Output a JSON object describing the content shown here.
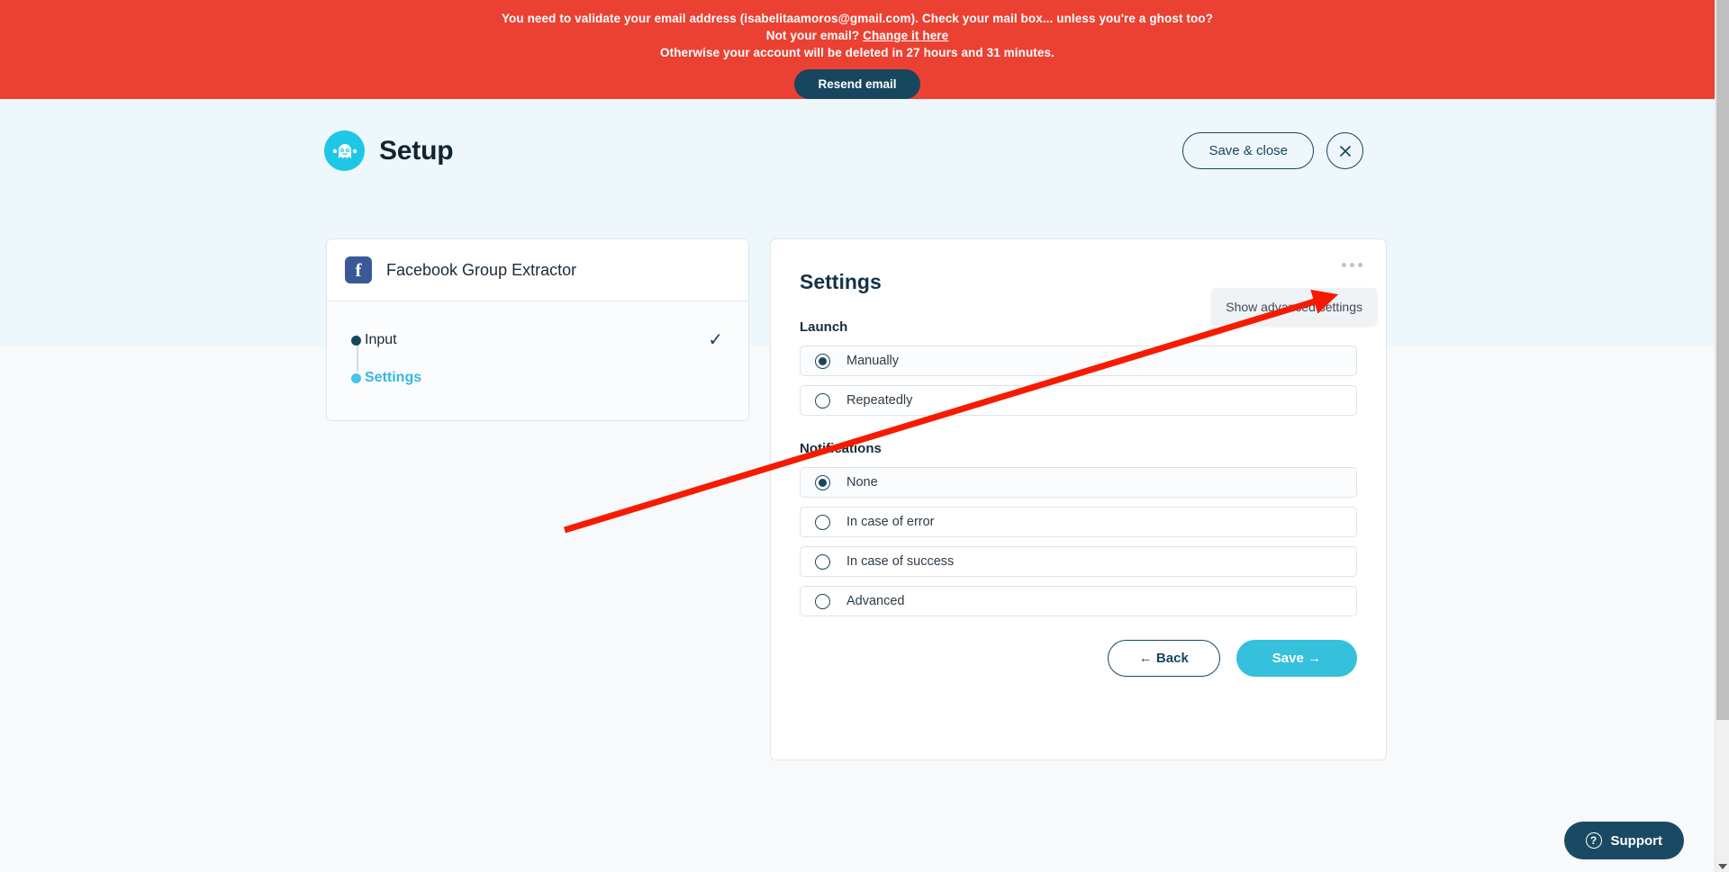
{
  "banner": {
    "line1": "You need to validate your email address (isabelitaamoros@gmail.com). Check your mail box... unless you're a ghost too?",
    "line2_prefix": "Not your email? ",
    "line2_link": "Change it here",
    "line3": "Otherwise your account will be deleted in 27 hours and 31 minutes.",
    "resend_label": "Resend email",
    "bg_color": "#eb4132",
    "button_color": "#17475e"
  },
  "header": {
    "title": "Setup",
    "logo_icon": "ghost-logo-icon",
    "save_close_label": "Save & close",
    "close_icon": "close-icon"
  },
  "left_card": {
    "app_icon": "facebook-icon",
    "app_name": "Facebook Group Extractor",
    "steps": [
      {
        "label": "Input",
        "state": "done",
        "check": "✓"
      },
      {
        "label": "Settings",
        "state": "active",
        "check": ""
      }
    ]
  },
  "settings_panel": {
    "title": "Settings",
    "kebab_icon": "more-options-icon",
    "advanced_tooltip": "Show advanced settings",
    "groups": [
      {
        "label": "Launch",
        "options": [
          {
            "label": "Manually",
            "selected": true
          },
          {
            "label": "Repeatedly",
            "selected": false
          }
        ]
      },
      {
        "label": "Notifications",
        "options": [
          {
            "label": "None",
            "selected": true
          },
          {
            "label": "In case of error",
            "selected": false
          },
          {
            "label": "In case of success",
            "selected": false
          },
          {
            "label": "Advanced",
            "selected": false
          }
        ]
      }
    ],
    "back_label": "← Back",
    "save_label": "Save →",
    "accent_color": "#35c0dc"
  },
  "support": {
    "label": "Support",
    "icon": "question-mark-icon"
  }
}
